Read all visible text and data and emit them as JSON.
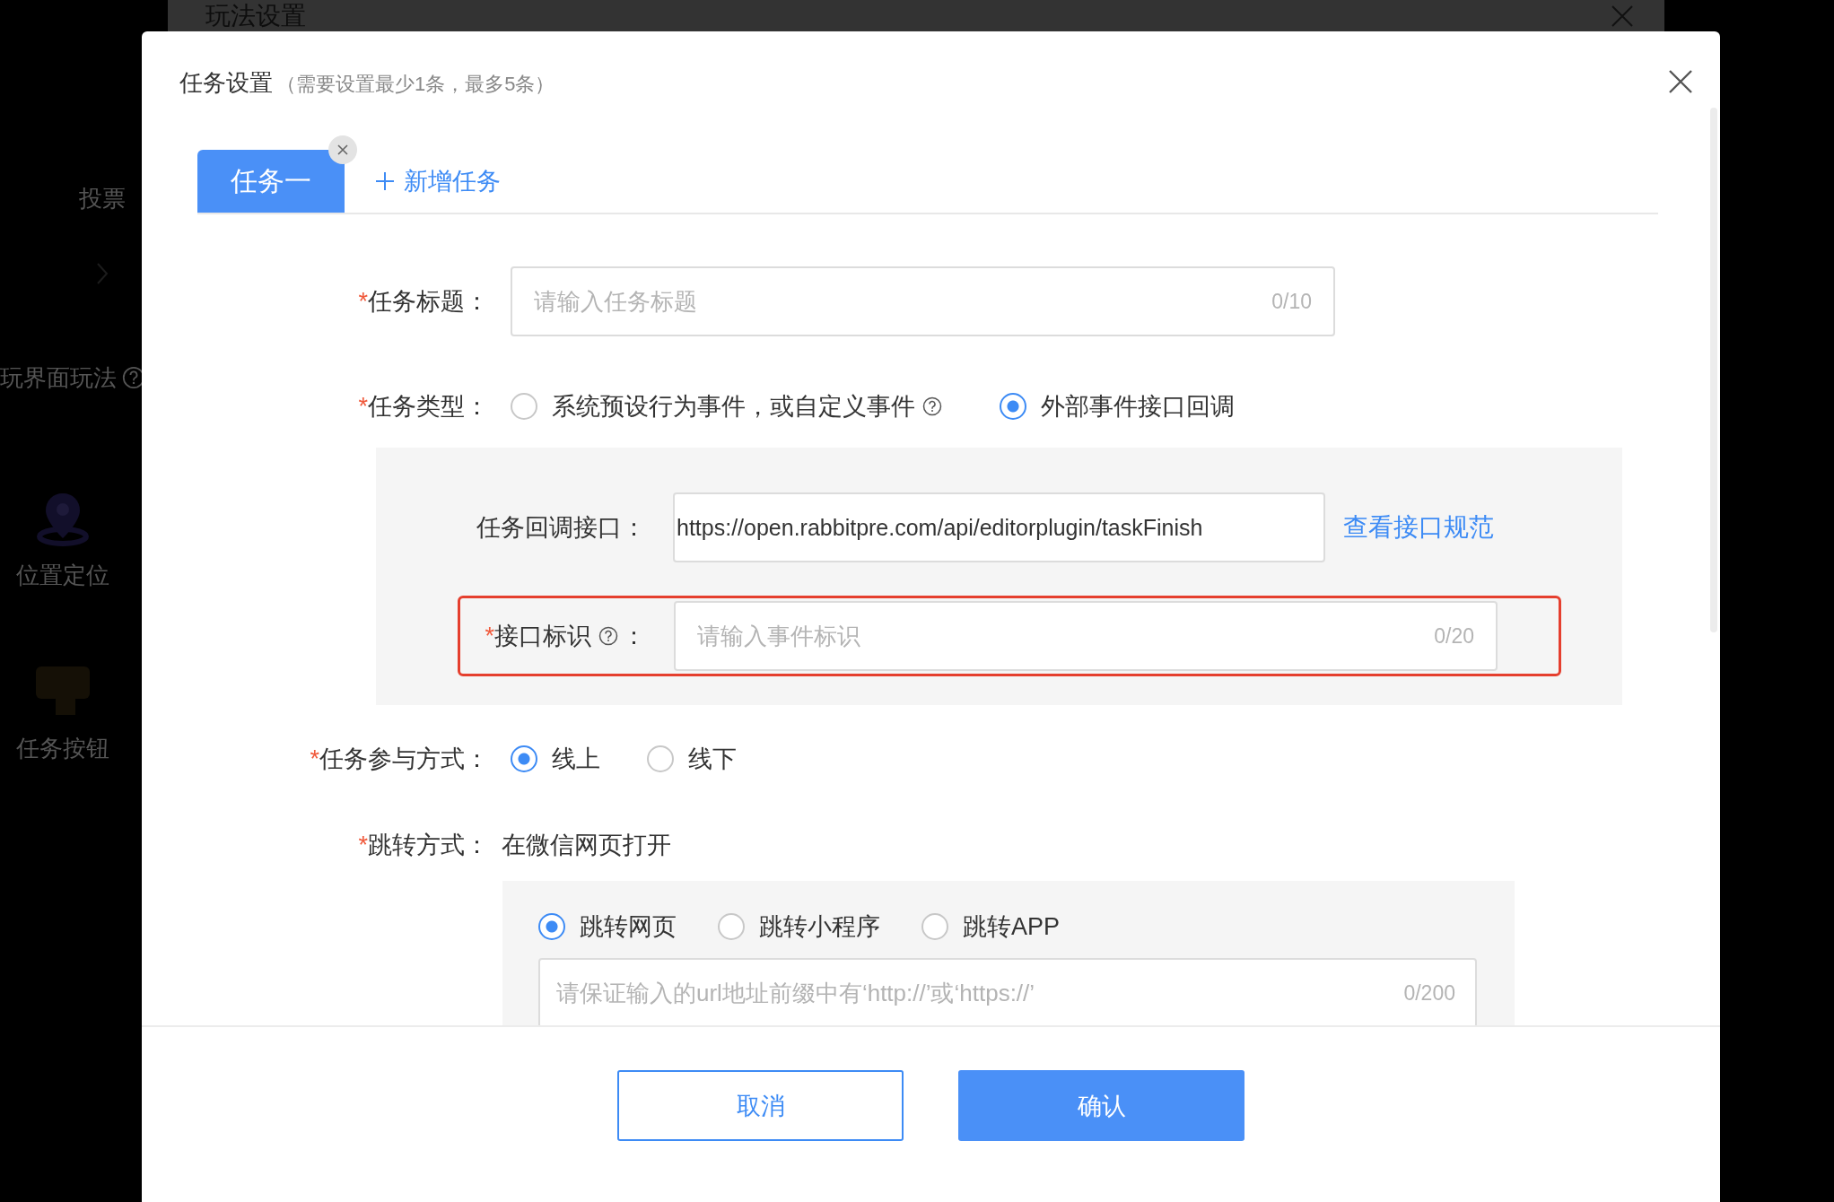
{
  "backdrop": {
    "title": "玩法设置",
    "side_items": [
      {
        "kind": "text",
        "label": "投票"
      },
      {
        "kind": "chevron"
      },
      {
        "kind": "text",
        "label": "玩界面玩法",
        "help": true
      },
      {
        "kind": "location",
        "label": "位置定位"
      },
      {
        "kind": "tap",
        "label": "任务按钮"
      }
    ]
  },
  "dialog": {
    "title": "任务设置",
    "subtitle": "（需要设置最少1条，最多5条）",
    "tabs": [
      {
        "label": "任务一",
        "selected": true,
        "closable": true
      }
    ],
    "add_tab": "新增任务",
    "fields": [
      {
        "kind": "input",
        "label": "任务标题：",
        "required_mark": "*",
        "placeholder": "请输入任务标题",
        "counter": "0/10"
      },
      {
        "kind": "radio",
        "label": "任务类型：",
        "required_mark": "*",
        "options": [
          {
            "label": "系统预设行为事件，或自定义事件",
            "help": true,
            "selected": false
          },
          {
            "label": "外部事件接口回调",
            "selected": true
          }
        ],
        "panel": {
          "rows": [
            {
              "kind": "link_input",
              "label": "任务回调接口：",
              "value": "https://open.rabbitpre.com/api/editorplugin/taskFinish",
              "link": "查看接口规范"
            },
            {
              "kind": "input",
              "label": "接口标识",
              "help": true,
              "label_suffix": "：",
              "required_mark": "*",
              "highlighted": true,
              "placeholder": "请输入事件标识",
              "counter": "0/20"
            }
          ]
        }
      },
      {
        "kind": "radio",
        "label": "任务参与方式：",
        "required_mark": "*",
        "options": [
          {
            "label": "线上",
            "selected": true
          },
          {
            "label": "线下",
            "selected": false
          }
        ]
      },
      {
        "kind": "static",
        "label": "跳转方式：",
        "required_mark": "*",
        "value": "在微信网页打开",
        "panel": {
          "rows": [
            {
              "kind": "radio",
              "options": [
                {
                  "label": "跳转网页",
                  "selected": true
                },
                {
                  "label": "跳转小程序",
                  "selected": false
                },
                {
                  "label": "跳转APP",
                  "selected": false
                }
              ]
            },
            {
              "kind": "input",
              "placeholder": "请保证输入的url地址前缀中有‘http://’或‘https://’",
              "counter": "0/200"
            }
          ]
        }
      }
    ],
    "buttons": [
      {
        "label": "取消",
        "kind": "secondary"
      },
      {
        "label": "确认",
        "kind": "primary"
      }
    ]
  }
}
